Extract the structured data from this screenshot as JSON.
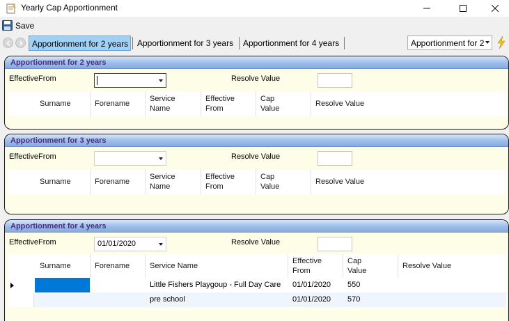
{
  "window": {
    "title": "Yearly Cap Apportionment",
    "controls": {
      "minimize": "minimize-icon",
      "maximize": "maximize-icon",
      "close": "close-icon"
    }
  },
  "toolbar": {
    "save_label": "Save",
    "save_icon": "floppy-disk-icon"
  },
  "navbar": {
    "tabs": [
      {
        "label": "Apportionment for 2 years",
        "active": true
      },
      {
        "label": "Apportionment for 3 years",
        "active": false
      },
      {
        "label": "Apportionment for 4 years",
        "active": false
      }
    ],
    "selector_value": "Apportionment for 2",
    "action_icon": "lightning-bolt-icon"
  },
  "panels": [
    {
      "title": "Apportionment for 2 years",
      "effective_from_label": "EffectiveFrom",
      "effective_from_value": "",
      "resolve_value_label": "Resolve Value",
      "resolve_value": "",
      "columns": [
        "Surname",
        "Forename",
        "Service Name",
        "Effective From",
        "Cap Value",
        "Resolve Value"
      ],
      "rows": []
    },
    {
      "title": "Apportionment for 3 years",
      "effective_from_label": "EffectiveFrom",
      "effective_from_value": "",
      "resolve_value_label": "Resolve Value",
      "resolve_value": "",
      "columns": [
        "Surname",
        "Forename",
        "Service Name",
        "Effective From",
        "Cap Value",
        "Resolve Value"
      ],
      "rows": []
    },
    {
      "title": "Apportionment for 4 years",
      "effective_from_label": "EffectiveFrom",
      "effective_from_value": "01/01/2020",
      "resolve_value_label": "Resolve Value",
      "resolve_value": "",
      "columns": [
        "Surname",
        "Forename",
        "Service Name",
        "Effective From",
        "Cap Value",
        "Resolve Value"
      ],
      "rows": [
        {
          "surname": "",
          "forename": "",
          "service_name": "Little Fishers Playgoup - Full Day Care",
          "effective_from": "01/01/2020",
          "cap_value": "550",
          "resolve_value": ""
        },
        {
          "surname": "",
          "forename": "",
          "service_name": "pre school",
          "effective_from": "01/01/2020",
          "cap_value": "570",
          "resolve_value": ""
        }
      ]
    }
  ],
  "colors": {
    "accent_tab": "#9fd0f5",
    "panel_header_text": "#4b2c84",
    "panel_background": "#fefee8",
    "selected_cell": "#0078d7",
    "alt_row": "#eef5fd"
  }
}
